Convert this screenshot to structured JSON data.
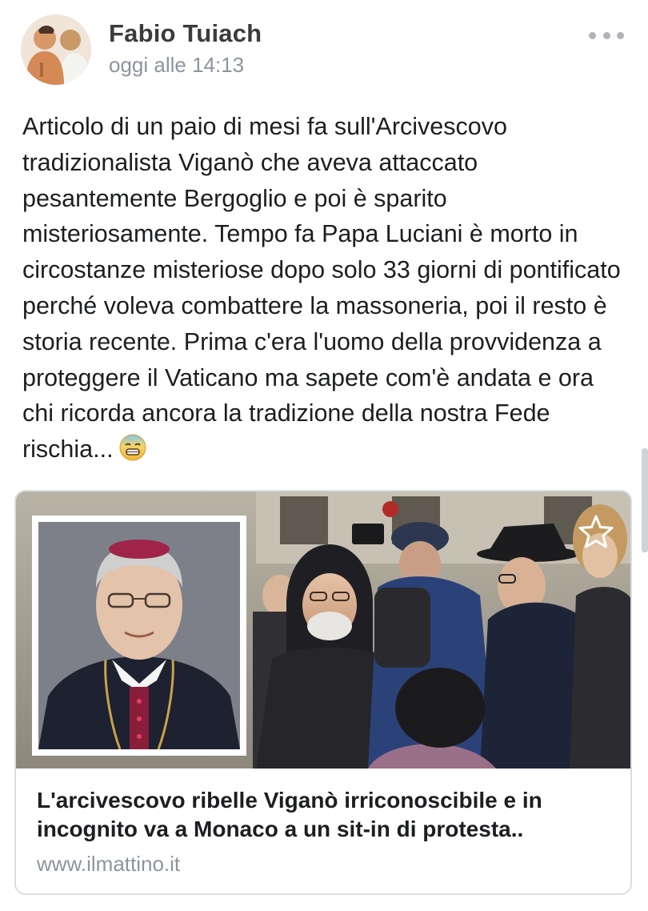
{
  "post": {
    "author": "Fabio Tuiach",
    "timestamp": "oggi alle 14:13",
    "text": "Articolo di un paio di mesi fa sull'Arcivescovo tradizionalista Viganò che aveva attaccato pesantemente Bergoglio e poi è sparito misteriosamente. Tempo fa Papa Luciani è morto in circostanze misteriose dopo solo 33 giorni di pontificato perché voleva combattere la massoneria, poi il resto è storia recente. Prima c'era l'uomo della provvidenza a proteggere il Vaticano ma sapete com'è andata e ora chi ricorda ancora la tradizione della nostra Fede rischia...",
    "emoji": "worried-sweat-emoji"
  },
  "link_preview": {
    "title": "L'arcivescovo ribelle Viganò irriconoscibile e in incognito va a Monaco a un sit-in di protesta..",
    "domain": "www.ilmattino.it",
    "save_icon": "star-icon"
  },
  "icons": {
    "more": "more-dots-icon",
    "avatar": "avatar"
  },
  "colors": {
    "name": "#3a3b3c",
    "meta": "#8d949e",
    "body_text": "#1c1e21",
    "card_border": "#dadde1"
  }
}
